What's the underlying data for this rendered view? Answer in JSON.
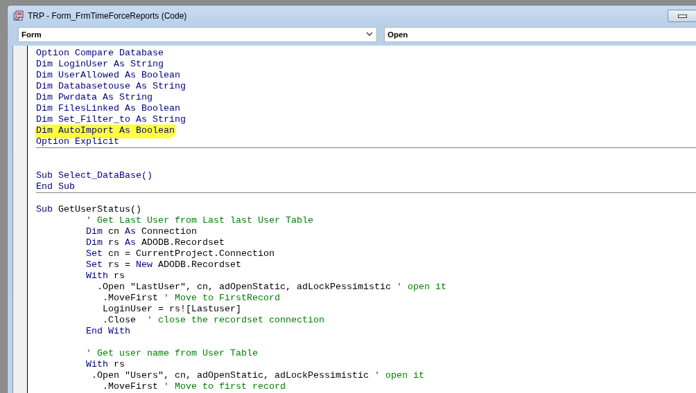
{
  "window": {
    "title": "TRP - Form_FrmTimeForceReports (Code)"
  },
  "object_combo": {
    "value": "Form"
  },
  "procedure_combo": {
    "value": "Open"
  },
  "sections": [
    {
      "lines": [
        {
          "kind": "code",
          "highlighted": false,
          "segments": [
            {
              "kind": "keyword",
              "text": "Option Compare Database"
            }
          ]
        },
        {
          "kind": "code",
          "highlighted": false,
          "segments": [
            {
              "kind": "keyword",
              "text": "Dim LoginUser As String"
            }
          ]
        },
        {
          "kind": "code",
          "highlighted": false,
          "segments": [
            {
              "kind": "keyword",
              "text": "Dim UserAllowed As Boolean"
            }
          ]
        },
        {
          "kind": "code",
          "highlighted": false,
          "segments": [
            {
              "kind": "keyword",
              "text": "Dim Databasetouse As String"
            }
          ]
        },
        {
          "kind": "code",
          "highlighted": false,
          "segments": [
            {
              "kind": "keyword",
              "text": "Dim Pwrdata As String"
            }
          ]
        },
        {
          "kind": "code",
          "highlighted": false,
          "segments": [
            {
              "kind": "keyword",
              "text": "Dim FilesLinked As Boolean"
            }
          ]
        },
        {
          "kind": "code",
          "highlighted": false,
          "segments": [
            {
              "kind": "keyword",
              "text": "Dim Set_Filter_to As String"
            }
          ]
        },
        {
          "kind": "code",
          "highlighted": true,
          "segments": [
            {
              "kind": "keyword",
              "text": "Dim AutoImport As Boolean"
            }
          ]
        },
        {
          "kind": "code",
          "highlighted": false,
          "segments": [
            {
              "kind": "keyword",
              "text": "Option Explicit"
            }
          ]
        }
      ]
    },
    {
      "lines": [
        {
          "kind": "blank"
        },
        {
          "kind": "blank"
        },
        {
          "kind": "code",
          "highlighted": false,
          "segments": [
            {
              "kind": "keyword",
              "text": "Sub Select_DataBase()"
            }
          ]
        },
        {
          "kind": "code",
          "highlighted": false,
          "segments": [
            {
              "kind": "keyword",
              "text": "End Sub"
            }
          ]
        }
      ]
    },
    {
      "lines": [
        {
          "kind": "blank"
        },
        {
          "kind": "code",
          "highlighted": false,
          "segments": [
            {
              "kind": "keyword",
              "text": "Sub "
            },
            {
              "kind": "text",
              "text": "GetUserStatus()"
            }
          ]
        },
        {
          "kind": "code",
          "highlighted": false,
          "segments": [
            {
              "kind": "comment",
              "text": "         ' Get Last User from Last last User Table"
            }
          ]
        },
        {
          "kind": "code",
          "highlighted": false,
          "segments": [
            {
              "kind": "keyword",
              "text": "         Dim "
            },
            {
              "kind": "text",
              "text": "cn "
            },
            {
              "kind": "keyword",
              "text": "As "
            },
            {
              "kind": "text",
              "text": "Connection"
            }
          ]
        },
        {
          "kind": "code",
          "highlighted": false,
          "segments": [
            {
              "kind": "keyword",
              "text": "         Dim "
            },
            {
              "kind": "text",
              "text": "rs "
            },
            {
              "kind": "keyword",
              "text": "As "
            },
            {
              "kind": "text",
              "text": "ADODB.Recordset"
            }
          ]
        },
        {
          "kind": "code",
          "highlighted": false,
          "segments": [
            {
              "kind": "keyword",
              "text": "         Set "
            },
            {
              "kind": "text",
              "text": "cn = CurrentProject.Connection"
            }
          ]
        },
        {
          "kind": "code",
          "highlighted": false,
          "segments": [
            {
              "kind": "keyword",
              "text": "         Set "
            },
            {
              "kind": "text",
              "text": "rs = "
            },
            {
              "kind": "keyword",
              "text": "New "
            },
            {
              "kind": "text",
              "text": "ADODB.Recordset"
            }
          ]
        },
        {
          "kind": "code",
          "highlighted": false,
          "segments": [
            {
              "kind": "keyword",
              "text": "         With "
            },
            {
              "kind": "text",
              "text": "rs"
            }
          ]
        },
        {
          "kind": "code",
          "highlighted": false,
          "segments": [
            {
              "kind": "text",
              "text": "           .Open \"LastUser\", cn, adOpenStatic, adLockPessimistic "
            },
            {
              "kind": "comment",
              "text": "' open it"
            }
          ]
        },
        {
          "kind": "code",
          "highlighted": false,
          "segments": [
            {
              "kind": "text",
              "text": "            .MoveFirst "
            },
            {
              "kind": "comment",
              "text": "' Move to FirstRecord"
            }
          ]
        },
        {
          "kind": "code",
          "highlighted": false,
          "segments": [
            {
              "kind": "text",
              "text": "            LoginUser = rs![Lastuser]"
            }
          ]
        },
        {
          "kind": "code",
          "highlighted": false,
          "segments": [
            {
              "kind": "text",
              "text": "            .Close  "
            },
            {
              "kind": "comment",
              "text": "' close the recordset connection"
            }
          ]
        },
        {
          "kind": "code",
          "highlighted": false,
          "segments": [
            {
              "kind": "keyword",
              "text": "         End With"
            }
          ]
        },
        {
          "kind": "blank"
        },
        {
          "kind": "code",
          "highlighted": false,
          "segments": [
            {
              "kind": "comment",
              "text": "         ' Get user name from User Table"
            }
          ]
        },
        {
          "kind": "code",
          "highlighted": false,
          "segments": [
            {
              "kind": "keyword",
              "text": "         With "
            },
            {
              "kind": "text",
              "text": "rs"
            }
          ]
        },
        {
          "kind": "code",
          "highlighted": false,
          "segments": [
            {
              "kind": "text",
              "text": "          .Open \"Users\", cn, adOpenStatic, adLockPessimistic "
            },
            {
              "kind": "comment",
              "text": "' open it"
            }
          ]
        },
        {
          "kind": "code",
          "highlighted": false,
          "segments": [
            {
              "kind": "text",
              "text": "            .MoveFirst "
            },
            {
              "kind": "comment",
              "text": "' Move to first record"
            }
          ]
        }
      ]
    }
  ]
}
